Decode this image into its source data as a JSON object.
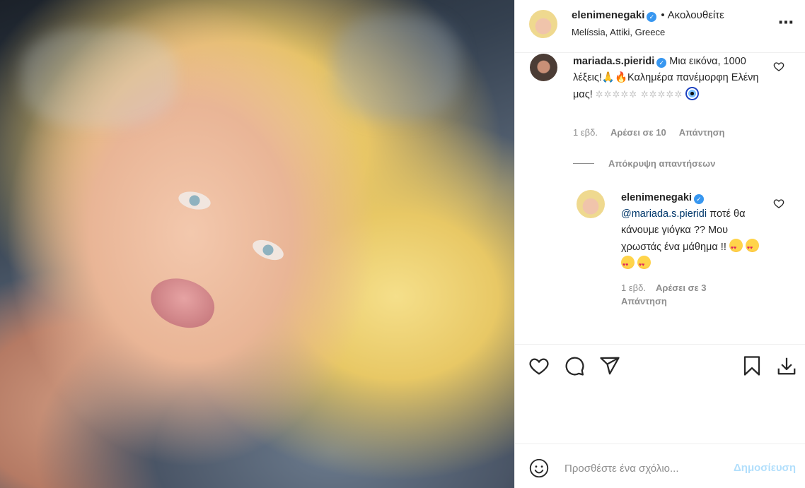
{
  "post": {
    "image_alt": ""
  },
  "header": {
    "username": "elenimenegaki",
    "separator": "•",
    "follow_status": "Ακολουθείτε",
    "location": "Melíssia, Attiki, Greece",
    "more_icon": "more-horizontal-icon"
  },
  "comments": [
    {
      "username": "mariada.s.pieridi",
      "text_part1": "Μια εικόνα, 1000 λέξεις!",
      "text_part2": "Καλημέρα πανέμορφη Ελένη μας!",
      "stars": "✲✲✲✲✲ ✲✲✲✲✲",
      "time": "1 εβδ.",
      "likes": "Αρέσει σε 10",
      "reply": "Απάντηση",
      "hide_replies": "Απόκρυψη απαντήσεων",
      "replies": [
        {
          "username": "elenimenegaki",
          "mention": "@mariada.s.pieridi",
          "text": "ποτέ θα κάνουμε γιόγκα ?? Μου χρωστάς ένα μάθημα !!",
          "time": "1 εβδ.",
          "likes": "Αρέσει σε 3",
          "reply": "Απάντηση"
        }
      ]
    }
  ],
  "actions": {
    "like_icon": "heart-icon",
    "comment_icon": "comment-icon",
    "share_icon": "share-icon",
    "save_icon": "bookmark-icon",
    "download_icon": "download-icon"
  },
  "add_comment": {
    "placeholder": "Προσθέστε ένα σχόλιο...",
    "post_label": "Δημοσίευση"
  },
  "colors": {
    "verified": "#3897f0",
    "post_button_disabled": "#b2dffc",
    "secondary_text": "#8e8e8e",
    "mention": "#00376b"
  }
}
